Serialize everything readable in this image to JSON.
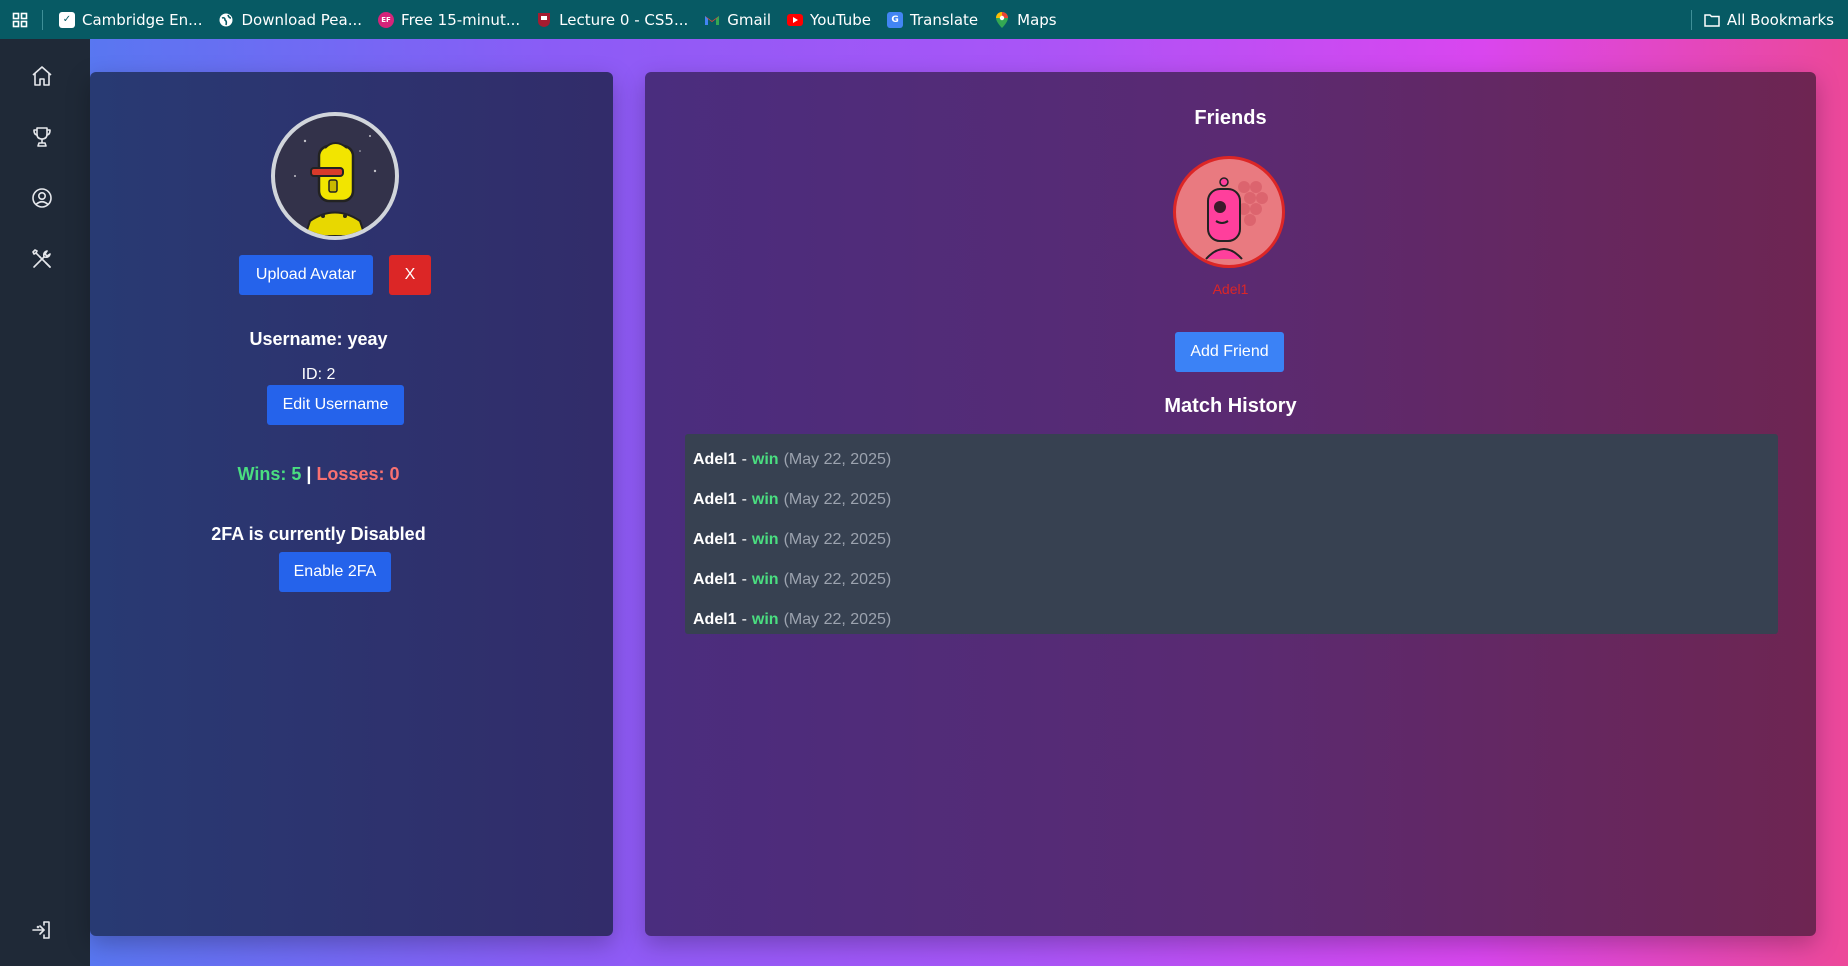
{
  "bookmarks": {
    "items": [
      {
        "label": "Cambridge En...",
        "icon": "checkbox-icon"
      },
      {
        "label": "Download Pea...",
        "icon": "globe-icon"
      },
      {
        "label": "Free 15-minut...",
        "icon": "ef-icon"
      },
      {
        "label": "Lecture 0 - CS5...",
        "icon": "harvard-icon"
      },
      {
        "label": "Gmail",
        "icon": "gmail-icon"
      },
      {
        "label": "YouTube",
        "icon": "youtube-icon"
      },
      {
        "label": "Translate",
        "icon": "translate-icon"
      },
      {
        "label": "Maps",
        "icon": "maps-icon"
      }
    ],
    "all_bookmarks": "All Bookmarks"
  },
  "sidebar": {
    "items": [
      {
        "name": "home",
        "icon": "home-icon"
      },
      {
        "name": "trophy",
        "icon": "trophy-icon"
      },
      {
        "name": "profile",
        "icon": "user-circle-icon"
      },
      {
        "name": "settings",
        "icon": "tools-icon"
      }
    ],
    "logout_icon": "logout-icon"
  },
  "profile": {
    "upload_avatar": "Upload Avatar",
    "remove_avatar": "X",
    "username": "Username: yeay",
    "id": "ID: 2",
    "edit_username": "Edit Username",
    "wins_label": "Wins: 5",
    "separator": "|",
    "losses_label": "Losses: 0",
    "twofa_status": "2FA is currently Disabled",
    "enable_2fa": "Enable 2FA"
  },
  "friends": {
    "title": "Friends",
    "list": [
      {
        "name": "Adel1"
      }
    ],
    "add_friend": "Add Friend"
  },
  "match_history": {
    "title": "Match History",
    "matches": [
      {
        "opponent": "Adel1",
        "dash": "-",
        "result": "win",
        "date": "(May 22, 2025)"
      },
      {
        "opponent": "Adel1",
        "dash": "-",
        "result": "win",
        "date": "(May 22, 2025)"
      },
      {
        "opponent": "Adel1",
        "dash": "-",
        "result": "win",
        "date": "(May 22, 2025)"
      },
      {
        "opponent": "Adel1",
        "dash": "-",
        "result": "win",
        "date": "(May 22, 2025)"
      },
      {
        "opponent": "Adel1",
        "dash": "-",
        "result": "win",
        "date": "(May 22, 2025)"
      }
    ]
  },
  "colors": {
    "wins": "#4ade80",
    "losses": "#f87171",
    "friend_name": "#dc2626",
    "primary_button": "#2563eb",
    "danger_button": "#dc2626"
  }
}
